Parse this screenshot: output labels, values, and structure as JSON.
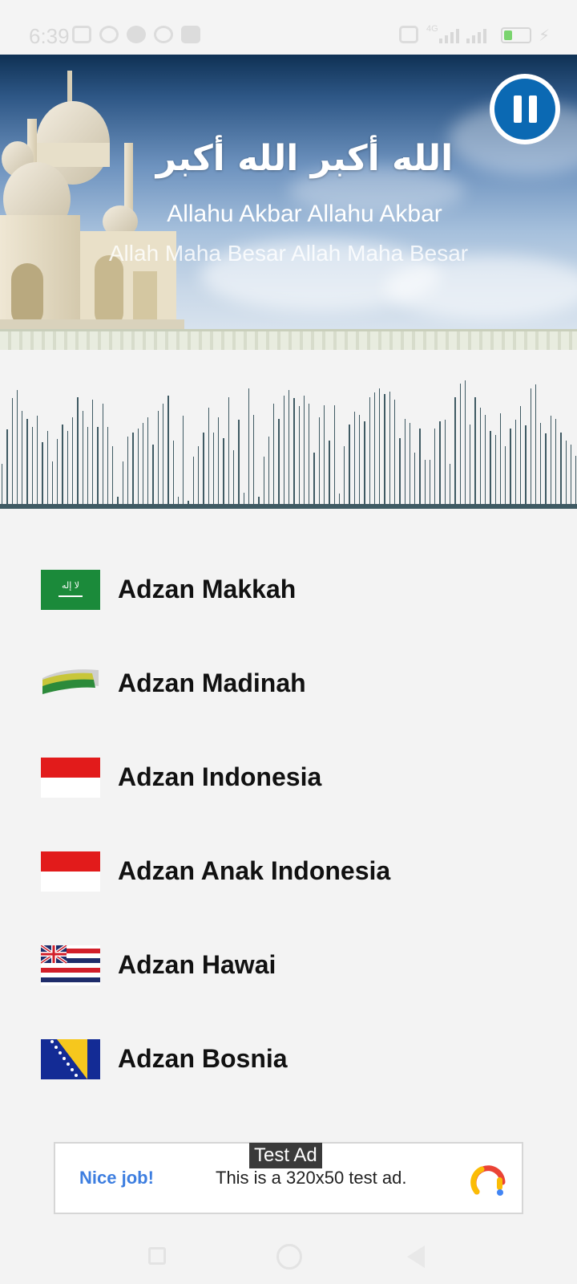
{
  "status_bar": {
    "time": "6:39",
    "network": "4G",
    "icons": [
      "nfc-off-icon",
      "alarm-icon",
      "app-icon",
      "whatsapp-icon",
      "message-icon",
      "vibrate-icon",
      "signal-icon",
      "battery-icon",
      "charging-icon"
    ]
  },
  "header": {
    "arabic_text": "الله أكبر الله أكبر",
    "latin_text": "Allahu Akbar Allahu Akbar",
    "translation_text": "Allah Maha Besar Allah Maha Besar",
    "pause_icon": "pause-icon",
    "accent_color": "#0b69b3"
  },
  "visualizer": {
    "bar_color": "#3f5a63",
    "levels": [
      0.33,
      0.58,
      0.81,
      0.87,
      0.72,
      0.66,
      0.6,
      0.68,
      0.49,
      0.57,
      0.35,
      0.51,
      0.62,
      0.57,
      0.67,
      0.82,
      0.72,
      0.6,
      0.8,
      0.6,
      0.77,
      0.6,
      0.46,
      0.09,
      0.35,
      0.53,
      0.56,
      0.59,
      0.63,
      0.67,
      0.47,
      0.72,
      0.77,
      0.83,
      0.5,
      0.09,
      0.68,
      0.06,
      0.38,
      0.46,
      0.56,
      0.74,
      0.56,
      0.67,
      0.52,
      0.82,
      0.43,
      0.65,
      0.12,
      0.88,
      0.69,
      0.09,
      0.38,
      0.53,
      0.77,
      0.66,
      0.83,
      0.87,
      0.81,
      0.75,
      0.83,
      0.77,
      0.41,
      0.67,
      0.76,
      0.5,
      0.76,
      0.11,
      0.46,
      0.62,
      0.71,
      0.69,
      0.64,
      0.82,
      0.85,
      0.88,
      0.84,
      0.86,
      0.8,
      0.52,
      0.66,
      0.63,
      0.41,
      0.59,
      0.36,
      0.36,
      0.59,
      0.64,
      0.65,
      0.33,
      0.82,
      0.92,
      0.94,
      0.62,
      0.82,
      0.74,
      0.69,
      0.57,
      0.54,
      0.7,
      0.46,
      0.59,
      0.65,
      0.75,
      0.61,
      0.88,
      0.91,
      0.63,
      0.55,
      0.68,
      0.66,
      0.56,
      0.5,
      0.47,
      0.39
    ]
  },
  "adzan_list": [
    {
      "label": "Adzan Makkah",
      "flag": "saudi-arabia-flag-icon"
    },
    {
      "label": "Adzan Madinah",
      "flag": "madinah-flag-icon"
    },
    {
      "label": "Adzan Indonesia",
      "flag": "indonesia-flag-icon"
    },
    {
      "label": "Adzan Anak Indonesia",
      "flag": "indonesia-flag-icon"
    },
    {
      "label": "Adzan Hawai",
      "flag": "hawaii-flag-icon"
    },
    {
      "label": "Adzan Bosnia",
      "flag": "bosnia-flag-icon"
    }
  ],
  "ad": {
    "label": "Test Ad",
    "nice_text": "Nice job!",
    "description": "This is a 320x50 test ad.",
    "logo": "admob-logo-icon"
  },
  "nav_bar": {
    "buttons": [
      "recent-apps-button",
      "home-button",
      "back-button"
    ]
  }
}
